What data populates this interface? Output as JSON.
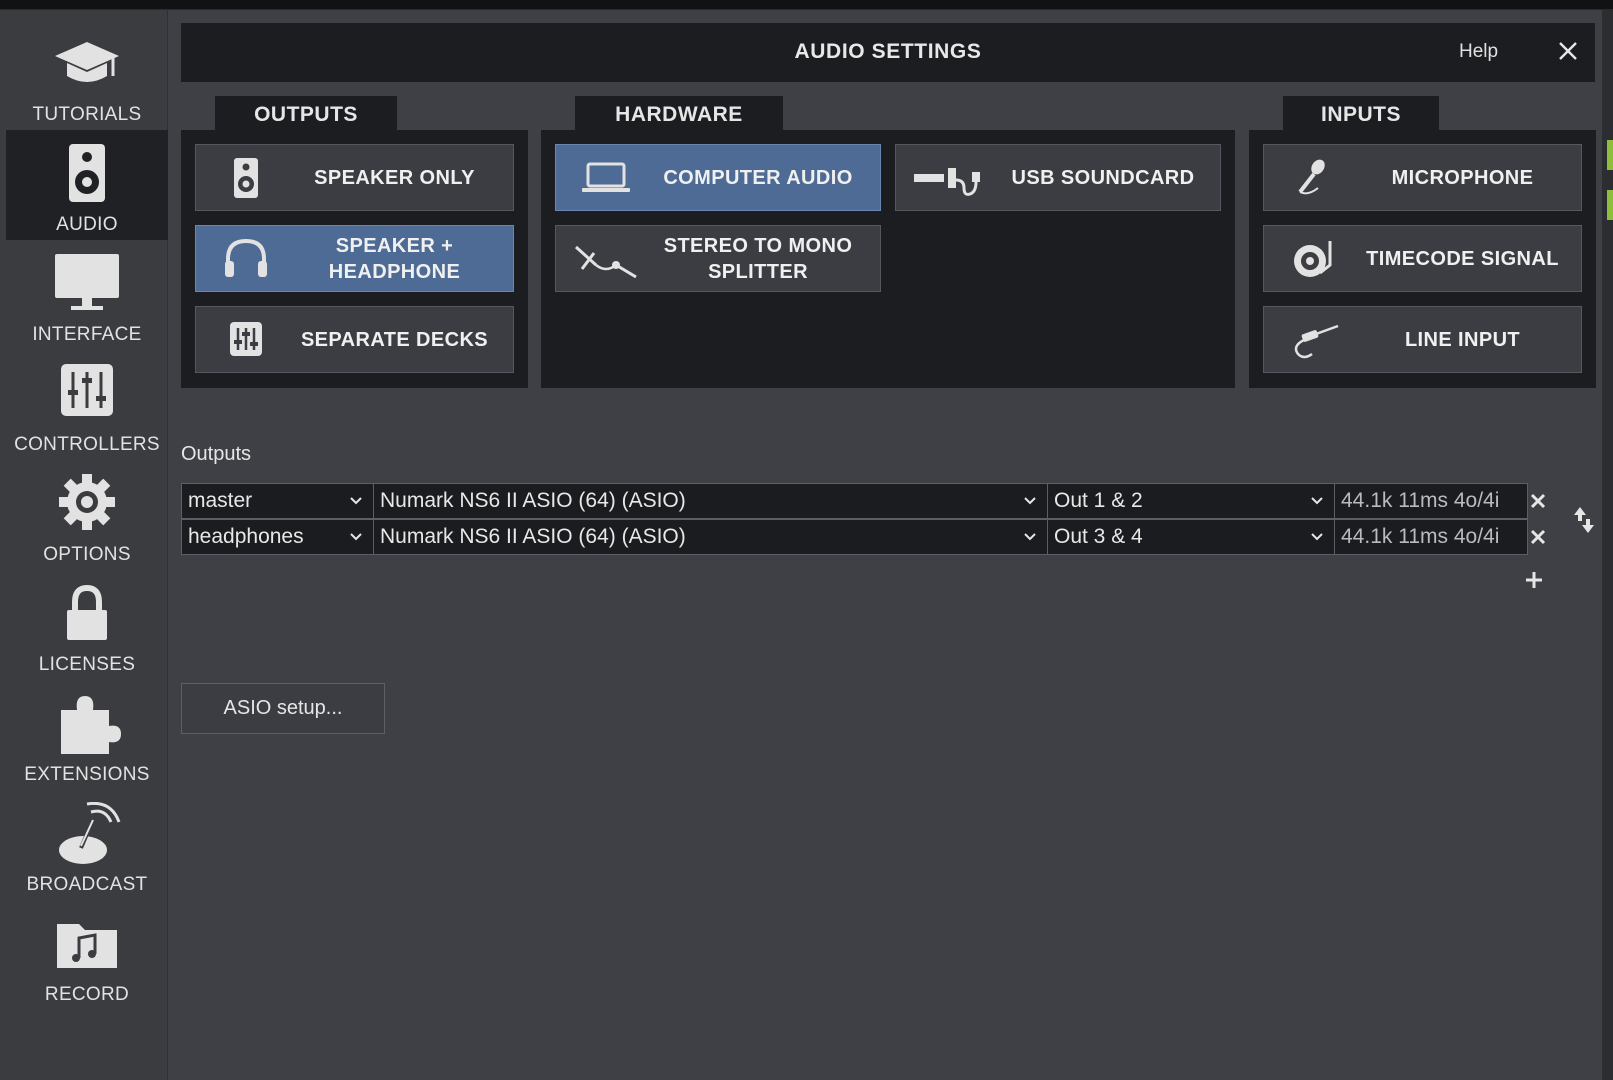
{
  "window": {
    "title": "AUDIO SETTINGS",
    "help_label": "Help"
  },
  "sidebar": {
    "items": [
      {
        "label": "TUTORIALS",
        "icon": "graduation-cap-icon",
        "active": false
      },
      {
        "label": "AUDIO",
        "icon": "speaker-icon",
        "active": true
      },
      {
        "label": "INTERFACE",
        "icon": "monitor-icon",
        "active": false
      },
      {
        "label": "CONTROLLERS",
        "icon": "mixer-faders-icon",
        "active": false
      },
      {
        "label": "OPTIONS",
        "icon": "gear-icon",
        "active": false
      },
      {
        "label": "LICENSES",
        "icon": "lock-icon",
        "active": false
      },
      {
        "label": "EXTENSIONS",
        "icon": "puzzle-piece-icon",
        "active": false
      },
      {
        "label": "BROADCAST",
        "icon": "satellite-dish-icon",
        "active": false
      },
      {
        "label": "RECORD",
        "icon": "music-folder-icon",
        "active": false
      }
    ]
  },
  "sections": {
    "outputs": {
      "title": "OUTPUTS",
      "options": [
        {
          "label": "SPEAKER ONLY",
          "icon": "speaker-icon",
          "selected": false
        },
        {
          "label_line1": "SPEAKER +",
          "label_line2": "HEADPHONE",
          "icon": "headphones-icon",
          "selected": true
        },
        {
          "label": "SEPARATE DECKS",
          "icon": "mixer-faders-icon",
          "selected": false
        }
      ]
    },
    "hardware": {
      "title": "HARDWARE",
      "options": [
        {
          "label": "COMPUTER AUDIO",
          "icon": "laptop-icon",
          "selected": true
        },
        {
          "label": "USB SOUNDCARD",
          "icon": "usb-cable-icon",
          "selected": false
        },
        {
          "label_line1": "STEREO TO MONO",
          "label_line2": "SPLITTER",
          "icon": "y-splitter-cable-icon",
          "selected": false
        }
      ]
    },
    "inputs": {
      "title": "INPUTS",
      "options": [
        {
          "label": "MICROPHONE",
          "icon": "microphone-icon",
          "selected": false
        },
        {
          "label": "TIMECODE SIGNAL",
          "icon": "turntable-icon",
          "selected": false
        },
        {
          "label": "LINE INPUT",
          "icon": "rca-cable-icon",
          "selected": false
        }
      ]
    }
  },
  "outputs_table": {
    "label": "Outputs",
    "rows": [
      {
        "channel": "master",
        "device": "Numark NS6 II ASIO (64) (ASIO)",
        "channels": "Out 1 & 2",
        "info": "44.1k 11ms 4o/4i"
      },
      {
        "channel": "headphones",
        "device": "Numark NS6 II ASIO (64) (ASIO)",
        "channels": "Out 3 & 4",
        "info": "44.1k 11ms 4o/4i"
      }
    ]
  },
  "asio_button": "ASIO setup...",
  "colors": {
    "background": "#3e4045",
    "panel": "#1c1d20",
    "selected": "#4d6b95",
    "button": "#3b3d42",
    "text": "#e6e6e6"
  }
}
